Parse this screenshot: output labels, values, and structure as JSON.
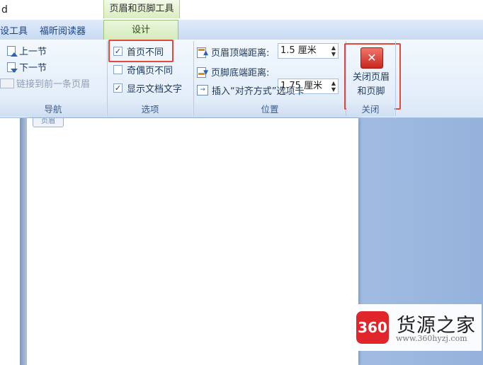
{
  "window": {
    "title_fragment": "d"
  },
  "context_tab_group": "页眉和页脚工具",
  "tabs": [
    {
      "label": "设工具"
    },
    {
      "label": "福昕阅读器"
    },
    {
      "label": "设计",
      "active": true
    }
  ],
  "groups": {
    "navigation": {
      "label": "导航",
      "items": [
        "上一节",
        "下一节",
        "链接到前一条页眉"
      ]
    },
    "options": {
      "label": "选项",
      "items": [
        {
          "label": "首页不同",
          "checked": true,
          "highlighted": true
        },
        {
          "label": "奇偶页不同",
          "checked": false
        },
        {
          "label": "显示文档文字",
          "checked": true
        }
      ]
    },
    "position": {
      "label": "位置",
      "header_from_top_label": "页眉顶端距离:",
      "header_from_top_value": "1.5 厘米",
      "footer_from_bottom_label": "页脚底端距离:",
      "footer_from_bottom_value": "1.75 厘米",
      "insert_alignment_tab": "插入“对齐方式”选项卡"
    },
    "close": {
      "label": "关闭",
      "button_label_line1": "关闭页眉",
      "button_label_line2": "和页脚"
    }
  },
  "document": {
    "header_tag": "页眉"
  },
  "watermark": {
    "badge": "360",
    "title": "货源之家",
    "url": "www.360hyzj.com"
  },
  "colors": {
    "highlight": "#e04a3c",
    "context_tab": "#d3ebba",
    "close_icon": "#c9261d"
  }
}
